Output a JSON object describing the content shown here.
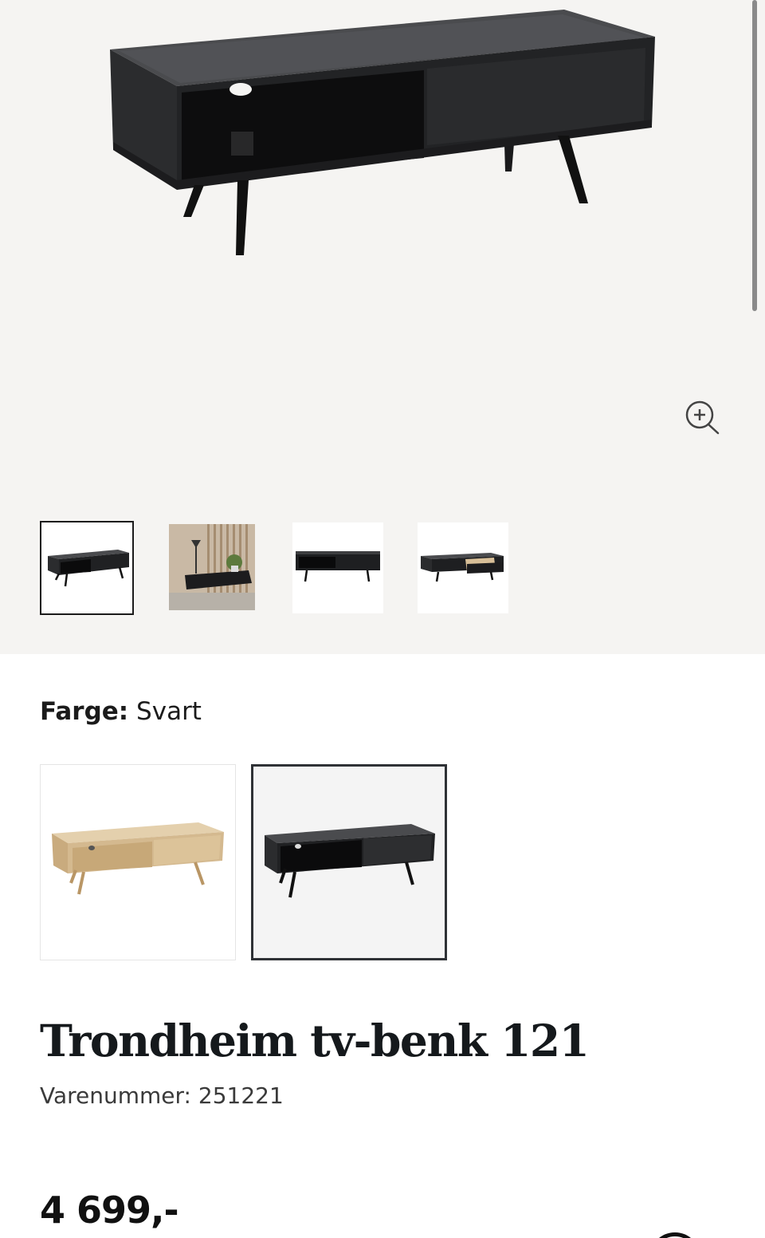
{
  "gallery": {
    "main_image_alt": "Trondheim tv-benk 121 svart",
    "zoom_icon": "zoom-in-icon",
    "thumbnails": [
      {
        "id": "thumb-1",
        "kind": "black-front",
        "selected": true
      },
      {
        "id": "thumb-2",
        "kind": "interior"
      },
      {
        "id": "thumb-3",
        "kind": "black-front-straight"
      },
      {
        "id": "thumb-4",
        "kind": "black-drawer-open"
      }
    ]
  },
  "color": {
    "label": "Farge:",
    "value": "Svart",
    "options": [
      {
        "name": "oak",
        "selected": false
      },
      {
        "name": "black",
        "selected": true
      }
    ]
  },
  "product": {
    "title": "Trondheim tv-benk 121",
    "sku": "Varenummer: 251221",
    "price": "4 699,-"
  },
  "colors": {
    "gallery_bg": "#f5f4f2",
    "selected_border": "#1b1b1b",
    "swatch_selected_border": "#2f3236",
    "text": "#1b1b1b"
  }
}
